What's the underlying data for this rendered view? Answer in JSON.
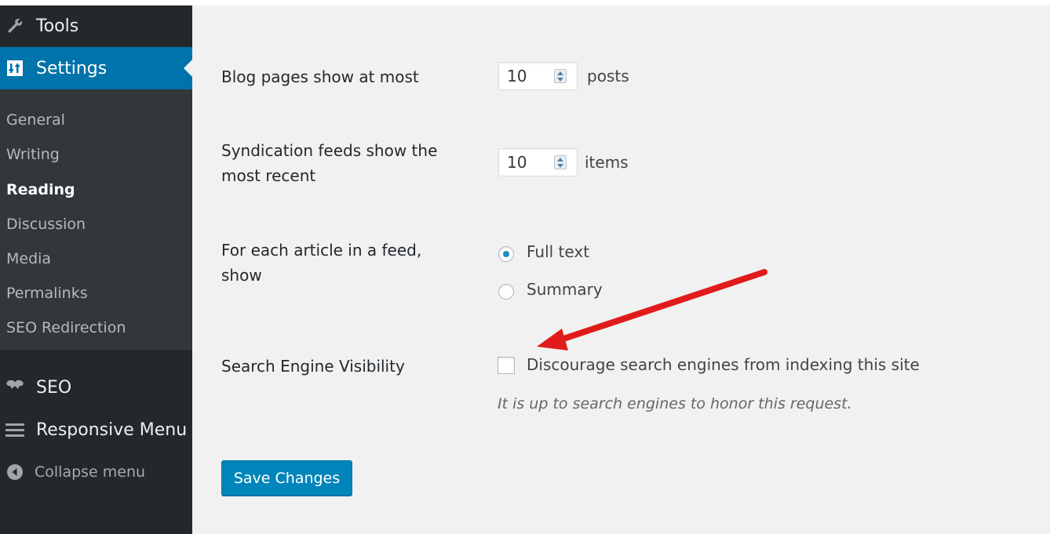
{
  "sidebar": {
    "tools": {
      "label": "Tools",
      "icon": "wrench-icon"
    },
    "settings": {
      "label": "Settings",
      "icon": "settings-icon"
    },
    "submenu": [
      {
        "label": "General"
      },
      {
        "label": "Writing"
      },
      {
        "label": "Reading",
        "current": true
      },
      {
        "label": "Discussion"
      },
      {
        "label": "Media"
      },
      {
        "label": "Permalinks"
      },
      {
        "label": "SEO Redirection"
      }
    ],
    "seo": {
      "label": "SEO",
      "icon": "seo-icon"
    },
    "responsive_menu": {
      "label": "Responsive Menu",
      "icon": "hamburger-icon"
    },
    "collapse": {
      "label": "Collapse menu",
      "icon": "collapse-icon"
    }
  },
  "form": {
    "blog_pages": {
      "label": "Blog pages show at most",
      "value": "10",
      "unit": "posts"
    },
    "syndication": {
      "label_line1": "Syndication feeds show the",
      "label_line2": "most recent",
      "value": "10",
      "unit": "items"
    },
    "feed_article": {
      "label_line1": "For each article in a feed,",
      "label_line2": "show",
      "options": [
        {
          "label": "Full text",
          "checked": true
        },
        {
          "label": "Summary",
          "checked": false
        }
      ]
    },
    "search_visibility": {
      "label": "Search Engine Visibility",
      "checkbox_label": "Discourage search engines from indexing this site",
      "checked": false,
      "help": "It is up to search engines to honor this request."
    },
    "save_label": "Save Changes"
  },
  "colors": {
    "sidebar_bg": "#23282d",
    "submenu_bg": "#32373c",
    "active_bg": "#0073aa",
    "main_bg": "#f1f1f1",
    "button_bg": "#0085ba",
    "annotation_arrow": "#e11b1b"
  }
}
